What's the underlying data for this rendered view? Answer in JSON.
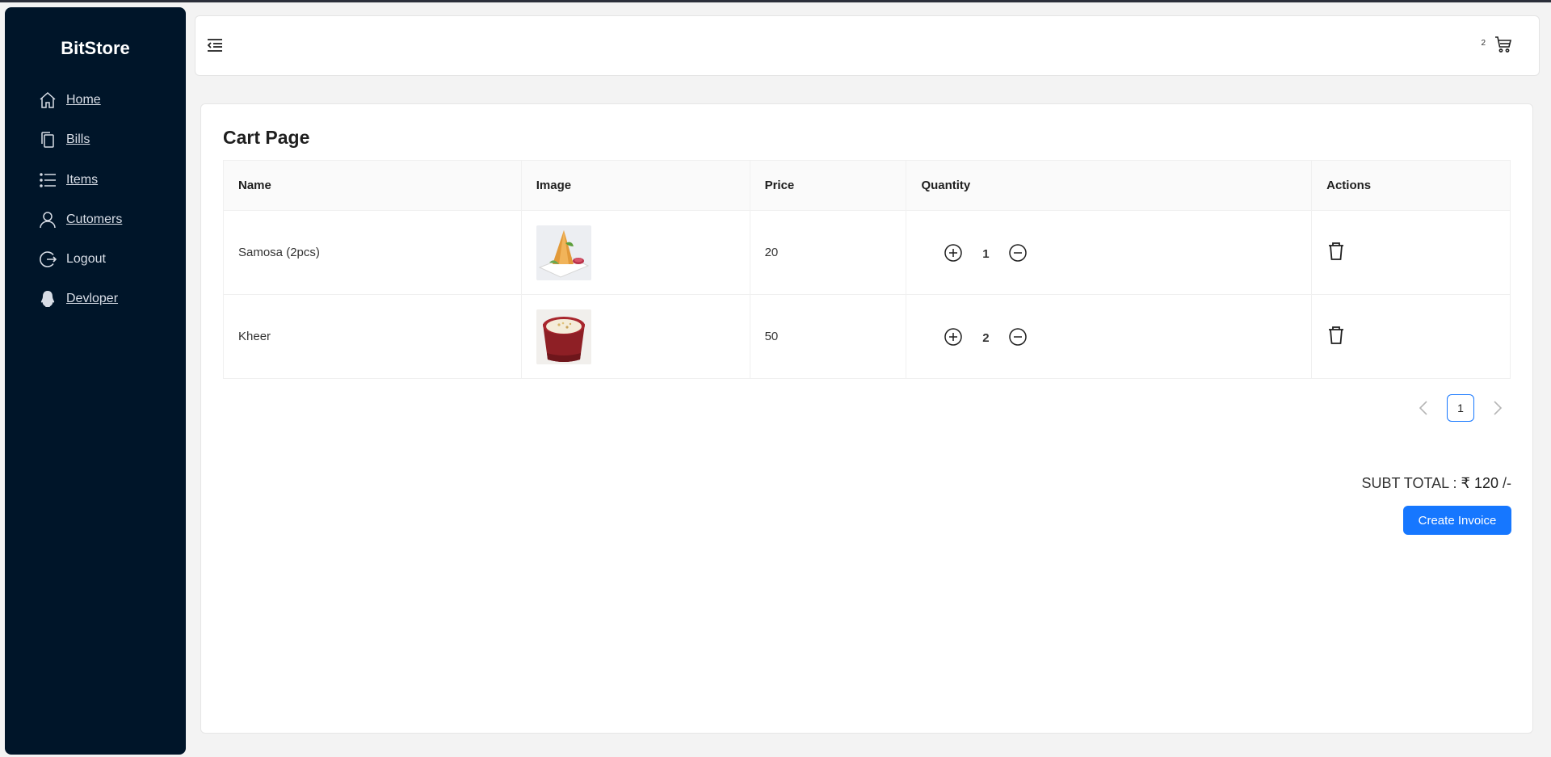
{
  "app": {
    "brand": "BitStore"
  },
  "sidebar": {
    "items": [
      {
        "label": "Home",
        "icon": "home-icon"
      },
      {
        "label": "Bills",
        "icon": "copy-icon"
      },
      {
        "label": "Items",
        "icon": "unordered-list-icon"
      },
      {
        "label": "Cutomers",
        "icon": "user-icon"
      },
      {
        "label": "Logout",
        "icon": "logout-icon"
      },
      {
        "label": "Devloper",
        "icon": "qq-icon"
      }
    ]
  },
  "header": {
    "cart_count": "2"
  },
  "page": {
    "title": "Cart Page"
  },
  "table": {
    "columns": [
      "Name",
      "Image",
      "Price",
      "Quantity",
      "Actions"
    ],
    "rows": [
      {
        "name": "Samosa (2pcs)",
        "price": "20",
        "quantity": "1",
        "image": "samosa-image"
      },
      {
        "name": "Kheer",
        "price": "50",
        "quantity": "2",
        "image": "kheer-image"
      }
    ]
  },
  "pagination": {
    "current": "1"
  },
  "summary": {
    "label": "SUBT TOTAL : ",
    "amount": "₹ 120",
    "suffix": " /-"
  },
  "actions": {
    "create_invoice": "Create Invoice"
  },
  "colors": {
    "sidebar_bg": "#001529",
    "primary": "#1677ff"
  }
}
